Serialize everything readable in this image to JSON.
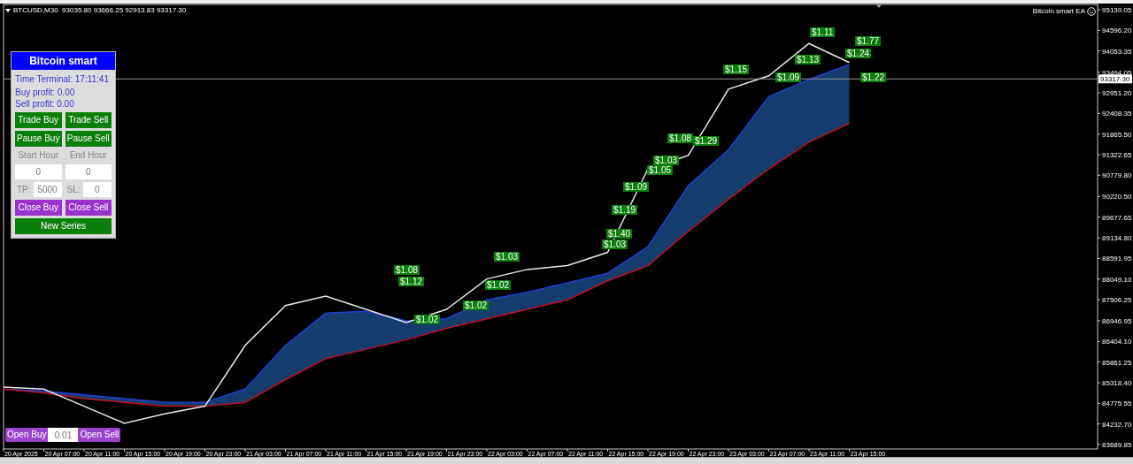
{
  "chart": {
    "header": "BTCUSD,M30  93035.80 93666.25 92913.83 93317.30",
    "expert": "Bitcoin smart EA",
    "chart_data": {
      "type": "line",
      "categories": [
        "20 Apr 2025",
        "20 Apr 07:00",
        "20 Apr 11:00",
        "20 Apr 15:00",
        "20 Apr 19:00",
        "20 Apr 23:00",
        "21 Apr 03:00",
        "21 Apr 07:00",
        "21 Apr 11:00",
        "21 Apr 15:00",
        "21 Apr 19:00",
        "21 Apr 23:00",
        "22 Apr 03:00",
        "22 Apr 07:00",
        "22 Apr 11:00",
        "22 Apr 15:00",
        "22 Apr 19:00",
        "22 Apr 23:00",
        "23 Apr 03:00",
        "23 Apr 07:00",
        "23 Apr 11:00",
        "23 Apr 15:00"
      ],
      "series": [
        {
          "color": "#e8e8e8",
          "values": [
            85200,
            85150,
            84700,
            84250,
            84500,
            84700,
            86300,
            87350,
            87600,
            87250,
            86900,
            87250,
            88050,
            88300,
            88400,
            88750,
            90950,
            91300,
            93050,
            93400,
            94250,
            93750
          ]
        },
        {
          "color": "#2040d0",
          "values": [
            85150,
            85100,
            85000,
            84900,
            84800,
            84800,
            85150,
            86300,
            87150,
            87200,
            86950,
            87000,
            87500,
            87700,
            87950,
            88200,
            88900,
            90500,
            91450,
            92850,
            93300,
            93700
          ]
        },
        {
          "color": "#c01020",
          "values": [
            85150,
            85050,
            84900,
            84800,
            84700,
            84700,
            84800,
            85400,
            85950,
            86200,
            86450,
            86750,
            87000,
            87250,
            87500,
            88000,
            88400,
            89300,
            90150,
            90950,
            91650,
            92150
          ]
        }
      ],
      "ylim": [
        83573,
        95279
      ],
      "yticks": [
        {
          "value": 95139.05,
          "label": "95139.05"
        },
        {
          "value": 94596.2,
          "label": "94596.20"
        },
        {
          "value": 94053.35,
          "label": "94053.35"
        },
        {
          "value": 93494.05,
          "label": "93494.05"
        },
        {
          "value": 92951.2,
          "label": "92951.20"
        },
        {
          "value": 92408.35,
          "label": "92408.35"
        },
        {
          "value": 91865.5,
          "label": "91865.50"
        },
        {
          "value": 91322.65,
          "label": "91322.65"
        },
        {
          "value": 90779.8,
          "label": "90779.80"
        },
        {
          "value": 90220.5,
          "label": "90220.50"
        },
        {
          "value": 89677.65,
          "label": "89677.65"
        },
        {
          "value": 89134.8,
          "label": "89134.80"
        },
        {
          "value": 88591.95,
          "label": "88591.95"
        },
        {
          "value": 88049.1,
          "label": "88049.10"
        },
        {
          "value": 87506.25,
          "label": "87506.25"
        },
        {
          "value": 86946.95,
          "label": "86946.95"
        },
        {
          "value": 86404.1,
          "label": "86404.10"
        },
        {
          "value": 85861.25,
          "label": "85861.25"
        },
        {
          "value": 85318.4,
          "label": "85318.40"
        },
        {
          "value": 84775.55,
          "label": "84775.55"
        },
        {
          "value": 84232.7,
          "label": "84232.70"
        },
        {
          "value": 83689.85,
          "label": "83689.85"
        }
      ],
      "ref_lines": [
        {
          "axis": "y",
          "value": 93317.3,
          "label": "93317.30",
          "color": "#9a9a9a"
        }
      ]
    },
    "profit_tags": [
      "$1.08",
      "$1.12",
      "$1.02",
      "$1.02",
      "$1.03",
      "$1.02",
      "$1.40",
      "$1.03",
      "$1.19",
      "$1.09",
      "$1.05",
      "$1.03",
      "$1.08",
      "$1.29",
      "$1.15",
      "$1.09",
      "$1.13",
      "$1.11",
      "$1.77",
      "$1.24",
      "$1.22"
    ]
  },
  "panel": {
    "title": "Bitcoin smart",
    "info": [
      "Time Terminal: 17:11:41",
      "Buy profit: 0.00",
      "Sell profit: 0.00"
    ],
    "rows": [
      {
        "kind": "buttons",
        "items": [
          {
            "label": "Trade Buy",
            "color": "#0a800a"
          },
          {
            "label": "Trade Sell",
            "color": "#0a800a"
          }
        ]
      },
      {
        "kind": "buttons",
        "items": [
          {
            "label": "Pause Buy",
            "color": "#0a800a"
          },
          {
            "label": "Pause Sell",
            "color": "#0a800a"
          }
        ]
      },
      {
        "kind": "captions",
        "items": [
          {
            "label": "Start Hour"
          },
          {
            "label": "End Hour"
          }
        ]
      },
      {
        "kind": "fields",
        "items": [
          {
            "value": "0"
          },
          {
            "value": "0"
          }
        ]
      },
      {
        "kind": "labeled-fields",
        "items": [
          {
            "label": "TP:",
            "value": "5000"
          },
          {
            "label": "SL:",
            "value": "0"
          }
        ]
      },
      {
        "kind": "buttons",
        "items": [
          {
            "label": "Close Buy",
            "color": "#9a33cc"
          },
          {
            "label": "Close Sell",
            "color": "#9a33cc"
          }
        ]
      },
      {
        "kind": "buttons",
        "items": [
          {
            "label": "New Series",
            "color": "#0a800a"
          }
        ]
      }
    ]
  },
  "quick_trade": {
    "buy": "Open Buy",
    "lot": "0.01",
    "sell": "Open Sell"
  }
}
